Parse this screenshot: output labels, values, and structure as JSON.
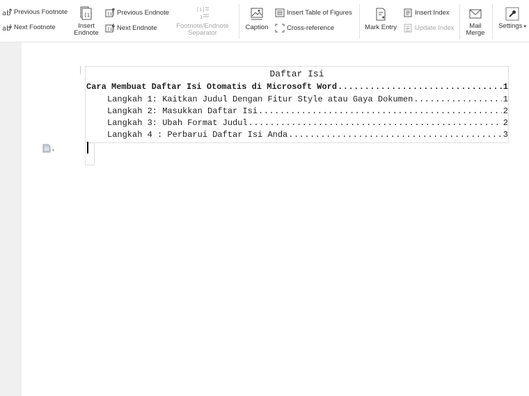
{
  "ribbon": {
    "previous_footnote": "Previous Footnote",
    "next_footnote": "Next Footnote",
    "insert_endnote_l1": "Insert",
    "insert_endnote_l2": "Endnote",
    "previous_endnote": "Previous Endnote",
    "next_endnote": "Next Endnote",
    "separator_l1": "Footnote/Endnote",
    "separator_l2": "Separator",
    "caption": "Caption",
    "insert_table_of_figures": "Insert Table of Figures",
    "cross_reference": "Cross-reference",
    "mark_entry": "Mark Entry",
    "insert_index": "Insert Index",
    "update_index": "Update Index",
    "mail_merge_l1": "Mail",
    "mail_merge_l2": "Merge",
    "settings": "Settings"
  },
  "document": {
    "toc_title": "Daftar Isi",
    "entries": [
      {
        "text": "Cara Membuat Daftar Isi Otomatis  di Microsoft Word",
        "page": "1",
        "level": 1
      },
      {
        "text": "Langkah 1: Kaitkan Judul Dengan Fitur Style atau Gaya Dokumen",
        "page": "1",
        "level": 2
      },
      {
        "text": "Langkah 2: Masukkan Daftar Isi",
        "page": "2",
        "level": 2
      },
      {
        "text": "Langkah 3: Ubah Format Judul",
        "page": "2",
        "level": 2
      },
      {
        "text": "Langkah 4 : Perbarui Daftar Isi Anda",
        "page": "3",
        "level": 2
      }
    ]
  },
  "colors": {
    "disabled": "#a8a8a8",
    "text": "#333333",
    "page": "#ffffff",
    "canvas": "#f2f2f2"
  }
}
